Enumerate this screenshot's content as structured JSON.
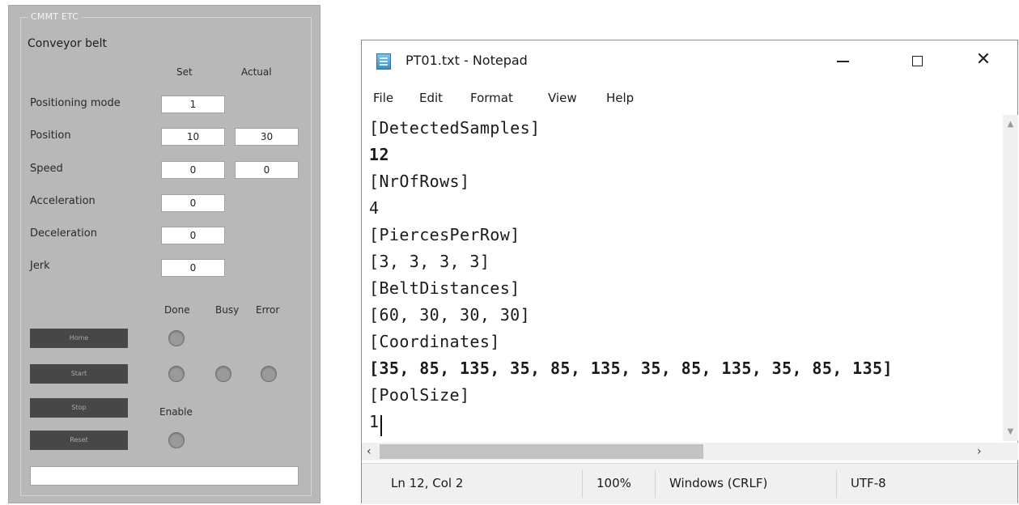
{
  "cmmt": {
    "group_title": "CMMT ETC",
    "subtitle": "Conveyor belt",
    "col_set": "Set",
    "col_actual": "Actual",
    "rows": [
      {
        "label": "Positioning mode",
        "set": "1",
        "actual": null
      },
      {
        "label": "Position",
        "set": "10",
        "actual": "30"
      },
      {
        "label": "Speed",
        "set": "0",
        "actual": "0"
      },
      {
        "label": "Acceleration",
        "set": "0",
        "actual": null
      },
      {
        "label": "Deceleration",
        "set": "0",
        "actual": null
      },
      {
        "label": "Jerk",
        "set": "0",
        "actual": null
      }
    ],
    "status_heads": {
      "done": "Done",
      "busy": "Busy",
      "error": "Error"
    },
    "buttons": {
      "home": "Home",
      "start": "Start",
      "stop": "Stop",
      "reset": "Reset"
    },
    "enable_label": "Enable",
    "status_text": ""
  },
  "notepad": {
    "title": "PT01.txt - Notepad",
    "menu": [
      "File",
      "Edit",
      "Format",
      "View",
      "Help"
    ],
    "lines": [
      "[DetectedSamples]",
      "12",
      "[NrOfRows]",
      "4",
      "[PiercesPerRow]",
      "[3, 3, 3, 3]",
      "[BeltDistances]",
      "[60, 30, 30, 30]",
      "[Coordinates]",
      "[35, 85, 135, 35, 85, 135, 35, 85, 135, 35, 85, 135]",
      "[PoolSize]",
      "1"
    ],
    "status": {
      "position": "Ln 12, Col 2",
      "zoom": "100%",
      "line_ending": "Windows (CRLF)",
      "encoding": "UTF-8"
    },
    "icons": {
      "minimize": "minimize-icon",
      "maximize": "maximize-icon",
      "close": "close-icon"
    }
  }
}
